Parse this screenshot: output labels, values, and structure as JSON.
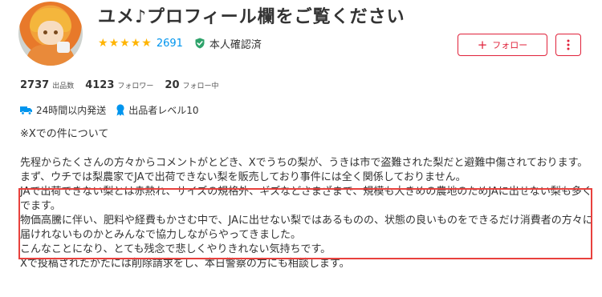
{
  "profile": {
    "name": "ユメ♪プロフィール欄をご覧ください",
    "rating_stars": 5,
    "review_count": "2691",
    "verified_label": "本人確認済"
  },
  "actions": {
    "follow_label": "フォロー",
    "more_icon": "vertical-ellipsis-icon"
  },
  "stats": [
    {
      "value": "2737",
      "label": "出品数"
    },
    {
      "value": "4123",
      "label": "フォロワー"
    },
    {
      "value": "20",
      "label": "フォロー中"
    }
  ],
  "badges": [
    {
      "icon": "truck-icon",
      "label": "24時間以内発送"
    },
    {
      "icon": "ribbon-icon",
      "label": "出品者レベル10"
    }
  ],
  "description": {
    "heading": "※Xでの件について",
    "p1": "先程からたくさんの方々からコメントがとどき、Xでうちの梨が、うきは市で盗難された梨だと避難中傷されております。",
    "p2": "まず、ウチでは梨農家でJAで出荷できない梨を販売しており事件には全く関係しておりません。",
    "p3": "JAで出荷できない梨とは赤熱れ、サイズの規格外、ギズなどさまざまで、規模も大きめの農地のためJAに出せない梨も多くでます。",
    "p4": "物価高騰に伴い、肥料や経費もかさむ中で、JAに出せない梨ではあるものの、状態の良いものをできるだけ消費者の方々に届けれないものかとみんなで協力しながらやってきました。",
    "p5": "こんなことになり、とても残念で悲しくやりきれない気持ちです。",
    "p6": "Xで投稿されたかたには削除請求をし、本日警察の方にも相談します。"
  },
  "colors": {
    "accent_red": "#e0213a",
    "star": "#ffb400",
    "link_blue": "#0095ee",
    "verified_green": "#2fa36b",
    "highlight_box": "#e8413d"
  }
}
